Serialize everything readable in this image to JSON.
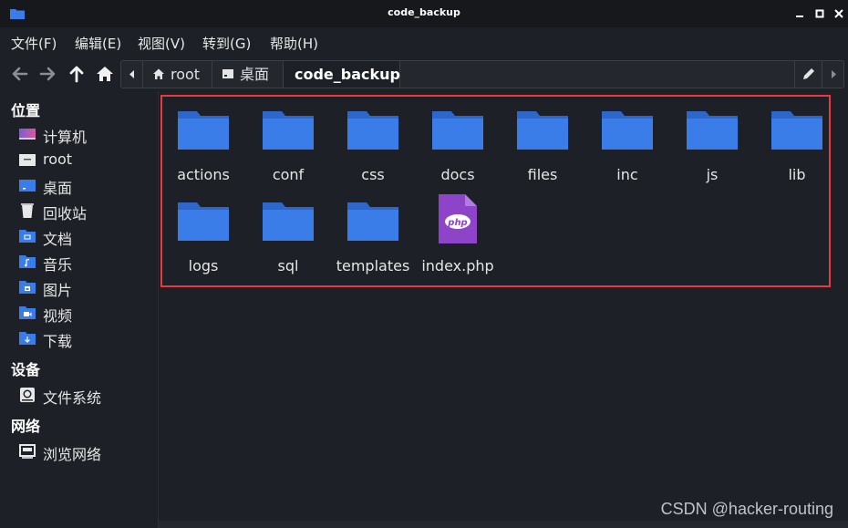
{
  "window": {
    "title": "code_backup",
    "controls": [
      "minimize",
      "maximize",
      "close"
    ]
  },
  "menu": [
    "文件(F)",
    "编辑(E)",
    "视图(V)",
    "转到(G)",
    "帮助(H)"
  ],
  "toolbar": {
    "nav_buttons": [
      "back-icon",
      "forward-icon",
      "up-icon",
      "home-icon"
    ]
  },
  "breadcrumbs": [
    {
      "label": "root",
      "icon": "home-icon"
    },
    {
      "label": "桌面",
      "icon": "desktop-icon"
    },
    {
      "label": "code_backup",
      "active": true
    }
  ],
  "sidebar": {
    "places_heading": "位置",
    "places": [
      {
        "label": "计算机",
        "icon": "computer-icon"
      },
      {
        "label": "root",
        "icon": "home-folder-icon"
      },
      {
        "label": "桌面",
        "icon": "desktop-folder-icon"
      },
      {
        "label": "回收站",
        "icon": "trash-icon"
      },
      {
        "label": "文档",
        "icon": "documents-folder-icon"
      },
      {
        "label": "音乐",
        "icon": "music-folder-icon"
      },
      {
        "label": "图片",
        "icon": "pictures-folder-icon"
      },
      {
        "label": "视频",
        "icon": "videos-folder-icon"
      },
      {
        "label": "下载",
        "icon": "downloads-folder-icon"
      }
    ],
    "devices_heading": "设备",
    "devices": [
      {
        "label": "文件系统",
        "icon": "drive-icon"
      }
    ],
    "network_heading": "网络",
    "network": [
      {
        "label": "浏览网络",
        "icon": "network-icon"
      }
    ]
  },
  "files": [
    {
      "name": "actions",
      "type": "folder"
    },
    {
      "name": "conf",
      "type": "folder"
    },
    {
      "name": "css",
      "type": "folder"
    },
    {
      "name": "docs",
      "type": "folder"
    },
    {
      "name": "files",
      "type": "folder"
    },
    {
      "name": "inc",
      "type": "folder"
    },
    {
      "name": "js",
      "type": "folder"
    },
    {
      "name": "lib",
      "type": "folder"
    },
    {
      "name": "logs",
      "type": "folder"
    },
    {
      "name": "sql",
      "type": "folder"
    },
    {
      "name": "templates",
      "type": "folder"
    },
    {
      "name": "index.php",
      "type": "php",
      "badge": "php"
    }
  ],
  "colors": {
    "folder": "#3b7de8",
    "folder_tab": "#2f67c9",
    "php": "#8e44c9",
    "highlight": "#e8393d",
    "background": "#1d2026"
  },
  "watermark": "CSDN @hacker-routing"
}
